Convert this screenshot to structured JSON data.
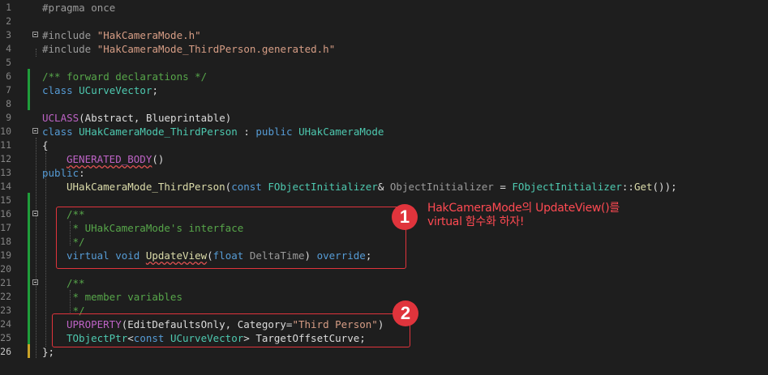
{
  "editor": {
    "line_numbers": [
      "1",
      "2",
      "3",
      "4",
      "5",
      "6",
      "7",
      "8",
      "9",
      "10",
      "11",
      "12",
      "13",
      "14",
      "15",
      "16",
      "17",
      "18",
      "19",
      "20",
      "21",
      "22",
      "23",
      "24",
      "25",
      "26"
    ],
    "current_line": "26",
    "lines": {
      "l1": {
        "p1": "#pragma once"
      },
      "l3": {
        "p1": "#include ",
        "p2": "\"HakCameraMode.h\""
      },
      "l4": {
        "p1": "#include ",
        "p2": "\"HakCameraMode_ThirdPerson.generated.h\""
      },
      "l6": {
        "p1": "/** forward declarations */"
      },
      "l7": {
        "p1": "class ",
        "p2": "UCurveVector",
        "p3": ";"
      },
      "l9": {
        "p1": "UCLASS",
        "p2": "(Abstract, Blueprintable)"
      },
      "l10": {
        "p1": "class ",
        "p2": "UHakCameraMode_ThirdPerson",
        "p3": " : ",
        "p4": "public ",
        "p5": "UHakCameraMode"
      },
      "l11": {
        "p1": "{"
      },
      "l12": {
        "p1": "GENERATED_BODY",
        "p2": "()"
      },
      "l13": {
        "p1": "public",
        "p2": ":"
      },
      "l14": {
        "p1": "UHakCameraMode_ThirdPerson",
        "p2": "(",
        "p3": "const ",
        "p4": "FObjectInitializer",
        "p5": "& ",
        "p6": "ObjectInitializer",
        "p7": " = ",
        "p8": "FObjectInitializer",
        "p9": "::",
        "p10": "Get",
        "p11": "());"
      },
      "l16": {
        "p1": "/**"
      },
      "l17": {
        "p1": " * UHakCameraMode's interface"
      },
      "l18": {
        "p1": " */"
      },
      "l19": {
        "p1": "virtual ",
        "p2": "void ",
        "p3": "UpdateView",
        "p4": "(",
        "p5": "float ",
        "p6": "DeltaTime",
        "p7": ") ",
        "p8": "override",
        "p9": ";"
      },
      "l21": {
        "p1": "/**"
      },
      "l22": {
        "p1": " * member variables"
      },
      "l23": {
        "p1": " */"
      },
      "l24": {
        "p1": "UPROPERTY",
        "p2": "(EditDefaultsOnly, Category=",
        "p3": "\"Third Person\"",
        "p4": ")"
      },
      "l25": {
        "p1": "TObjectPtr",
        "p2": "<",
        "p3": "const ",
        "p4": "UCurveVector",
        "p5": "> ",
        "p6": "TargetOffsetCurve",
        "p7": ";"
      },
      "l26": {
        "p1": "};"
      }
    }
  },
  "annotations": {
    "badge1": "1",
    "badge2": "2",
    "note1_line1": "HakCameraMode의 UpdateView()를",
    "note1_line2": "virtual 함수화 하자!"
  },
  "colors": {
    "background": "#1e1e1e",
    "keyword": "#569cd6",
    "type": "#4ec9b0",
    "string": "#d69d85",
    "comment": "#57a64a",
    "macro": "#bd63c5",
    "function": "#dcdcaa",
    "annotation_red": "#e0343c",
    "change_bar_green": "#1f9d3a",
    "change_bar_yellow": "#c9a227"
  }
}
